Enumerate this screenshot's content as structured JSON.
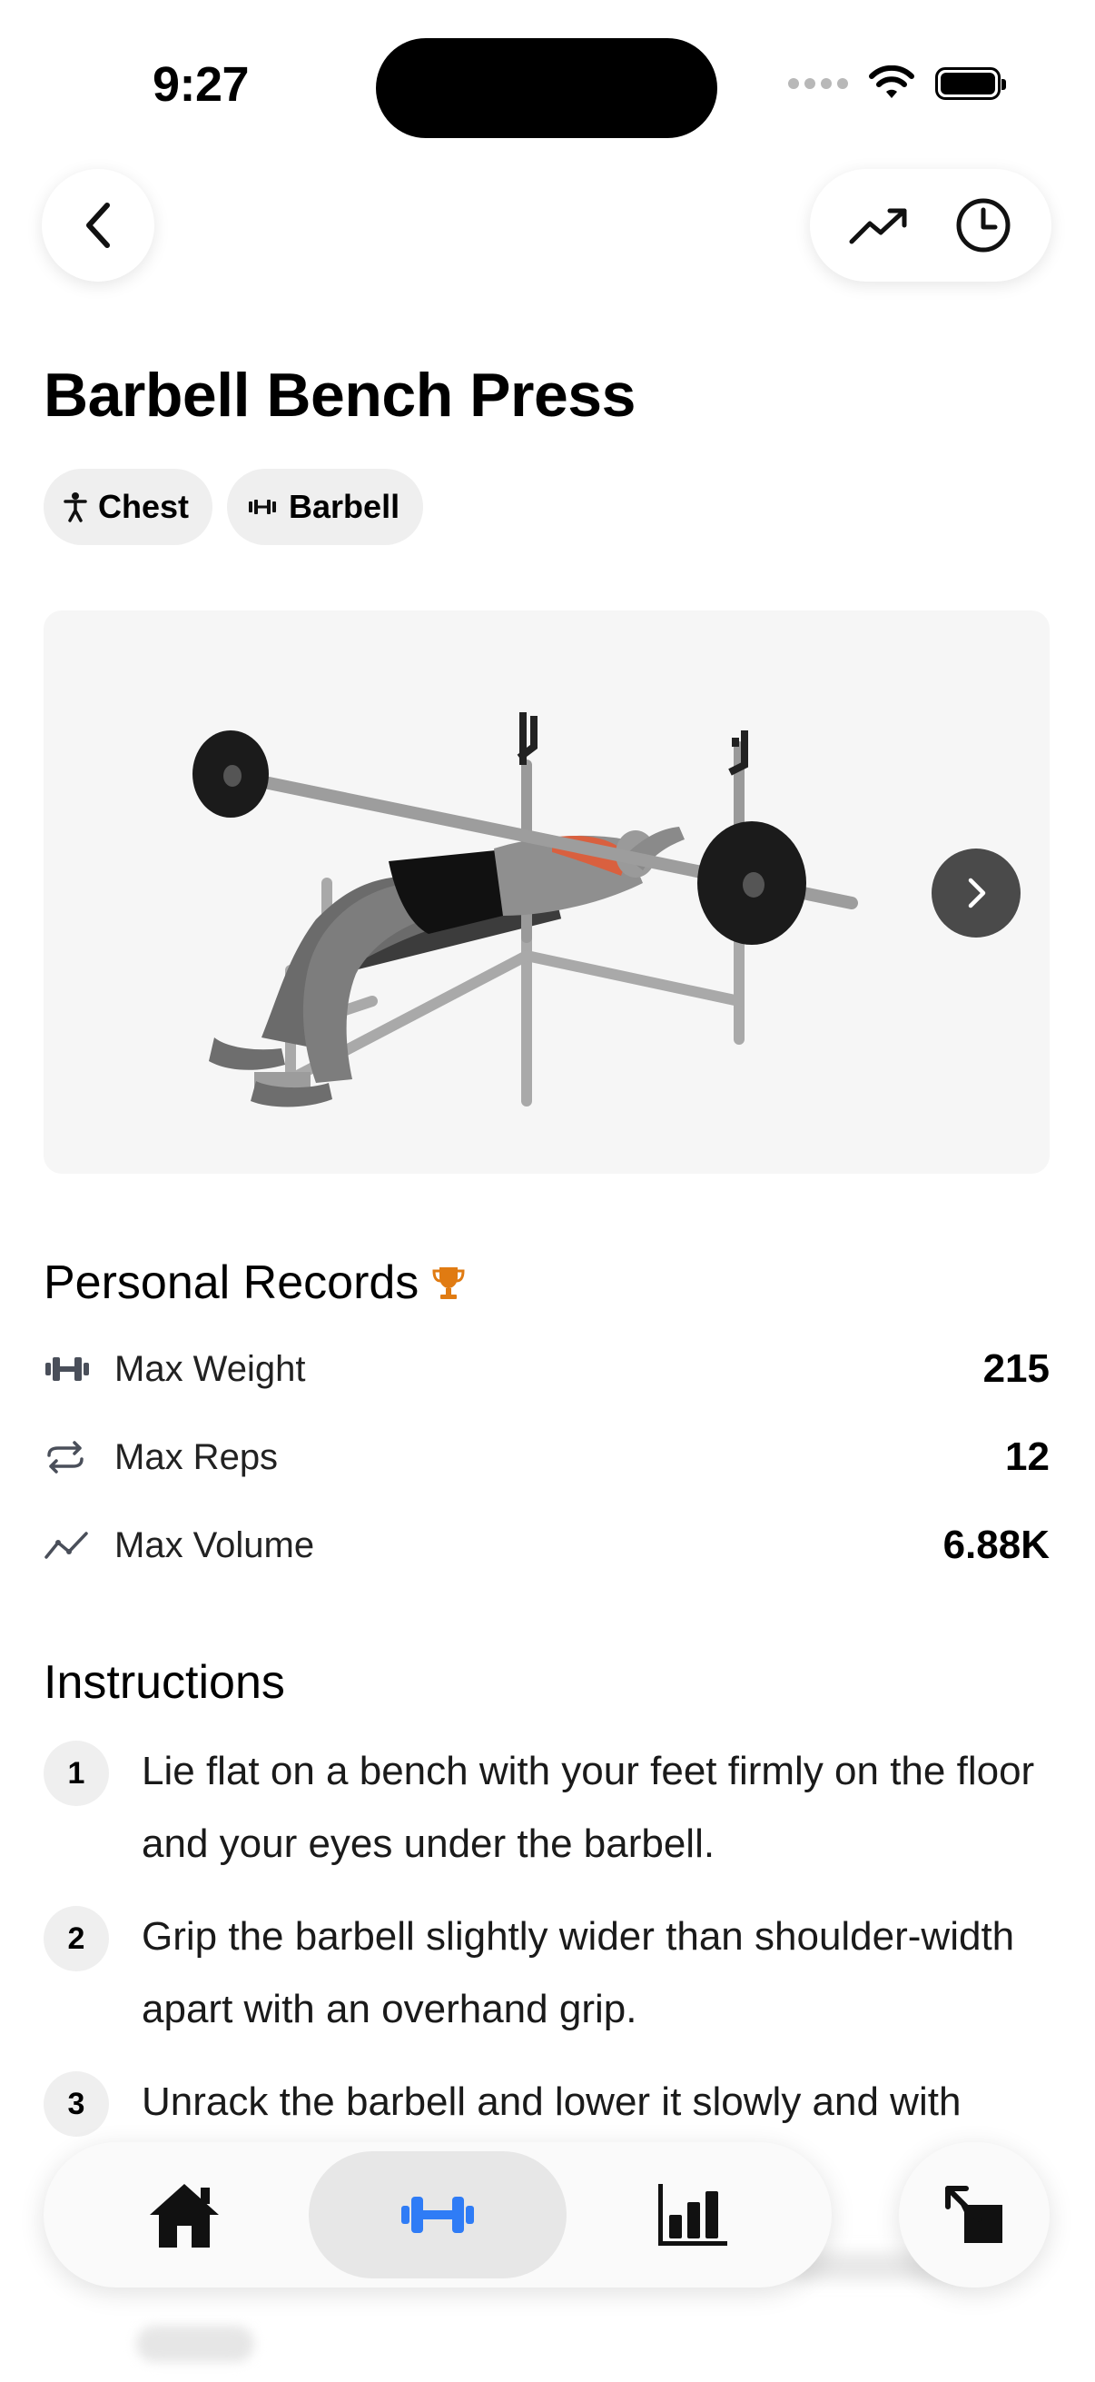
{
  "status_bar": {
    "time": "9:27"
  },
  "nav": {
    "back_icon": "chevron-left-icon",
    "progress_icon": "trending-up-icon",
    "history_icon": "clock-icon"
  },
  "exercise": {
    "title": "Barbell Bench Press",
    "tags": [
      {
        "label": "Chest",
        "icon": "body-icon"
      },
      {
        "label": "Barbell",
        "icon": "barbell-icon"
      }
    ]
  },
  "personal_records": {
    "heading": "Personal Records",
    "items": [
      {
        "label": "Max Weight",
        "value": "215",
        "icon": "dumbbell-icon"
      },
      {
        "label": "Max Reps",
        "value": "12",
        "icon": "repeat-icon"
      },
      {
        "label": "Max Volume",
        "value": "6.88K",
        "icon": "trend-icon"
      }
    ]
  },
  "instructions": {
    "heading": "Instructions",
    "steps": [
      {
        "n": "1",
        "text": "Lie flat on a bench with your feet firmly on the floor and your eyes under the barbell."
      },
      {
        "n": "2",
        "text": "Grip the barbell slightly wider than shoulder-width apart with an overhand grip."
      },
      {
        "n": "3",
        "text": "Unrack the barbell and lower it slowly and with"
      }
    ]
  },
  "tab_bar": {
    "tabs": [
      {
        "name": "home",
        "icon": "home-icon",
        "active": false
      },
      {
        "name": "workouts",
        "icon": "dumbbell-icon",
        "active": true
      },
      {
        "name": "stats",
        "icon": "bar-chart-icon",
        "active": false
      }
    ],
    "fab_icon": "expand-arrow-icon"
  },
  "colors": {
    "accent": "#2f7cf6",
    "trophy": "#e07b12",
    "chip_bg": "#efefef",
    "muscle_highlight": "#d9603f"
  }
}
